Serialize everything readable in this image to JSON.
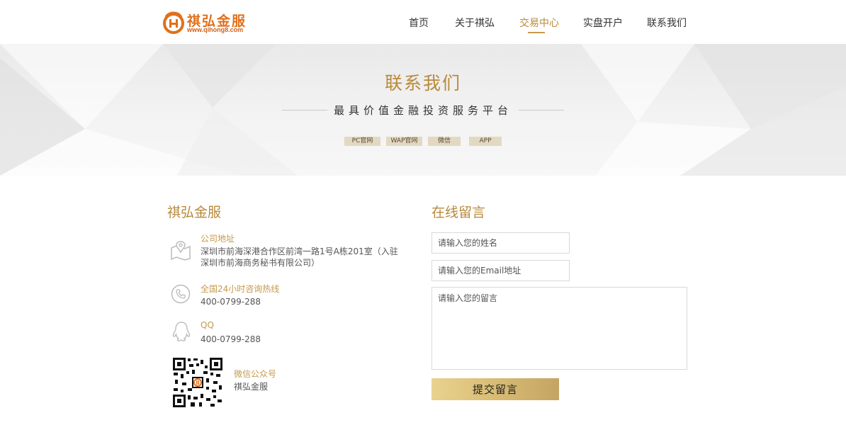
{
  "header": {
    "logo_name": "祺弘金服",
    "logo_url": "www.qihong8.com",
    "nav": [
      {
        "label": "首页"
      },
      {
        "label": "关于祺弘"
      },
      {
        "label": "交易中心"
      },
      {
        "label": "实盘开户"
      },
      {
        "label": "联系我们"
      }
    ],
    "active_nav_index": 2,
    "active_color": "#b88a3a"
  },
  "banner": {
    "title": "联系我们",
    "subtitle": "最具价值金融投资服务平台",
    "tags": [
      "PC官网",
      "WAP官网",
      "微信",
      "APP"
    ]
  },
  "contact": {
    "title": "祺弘金服",
    "items": [
      {
        "icon": "map-pin-icon",
        "label": "公司地址",
        "text": "深圳市前海深港合作区前湾一路1号A栋201室（入驻深圳市前海商务秘书有限公司）"
      },
      {
        "icon": "phone-icon",
        "label": "全国24小时咨询热线",
        "text": "400-0799-288"
      },
      {
        "icon": "qq-icon",
        "label": "QQ",
        "text": "400-0799-288"
      },
      {
        "icon": "qr-code-icon",
        "label": "微信公众号",
        "text": "祺弘金服"
      }
    ]
  },
  "form": {
    "title": "在线留言",
    "name_placeholder": "请输入您的姓名",
    "email_placeholder": "请输入您的Email地址",
    "message_placeholder": "请输入您的留言",
    "submit_label": "提交留言"
  },
  "colors": {
    "accent": "#b88a3a",
    "logo": "#e0701c",
    "tag_bg": "#e3d8c2",
    "button_gold": "#d8bc74"
  }
}
